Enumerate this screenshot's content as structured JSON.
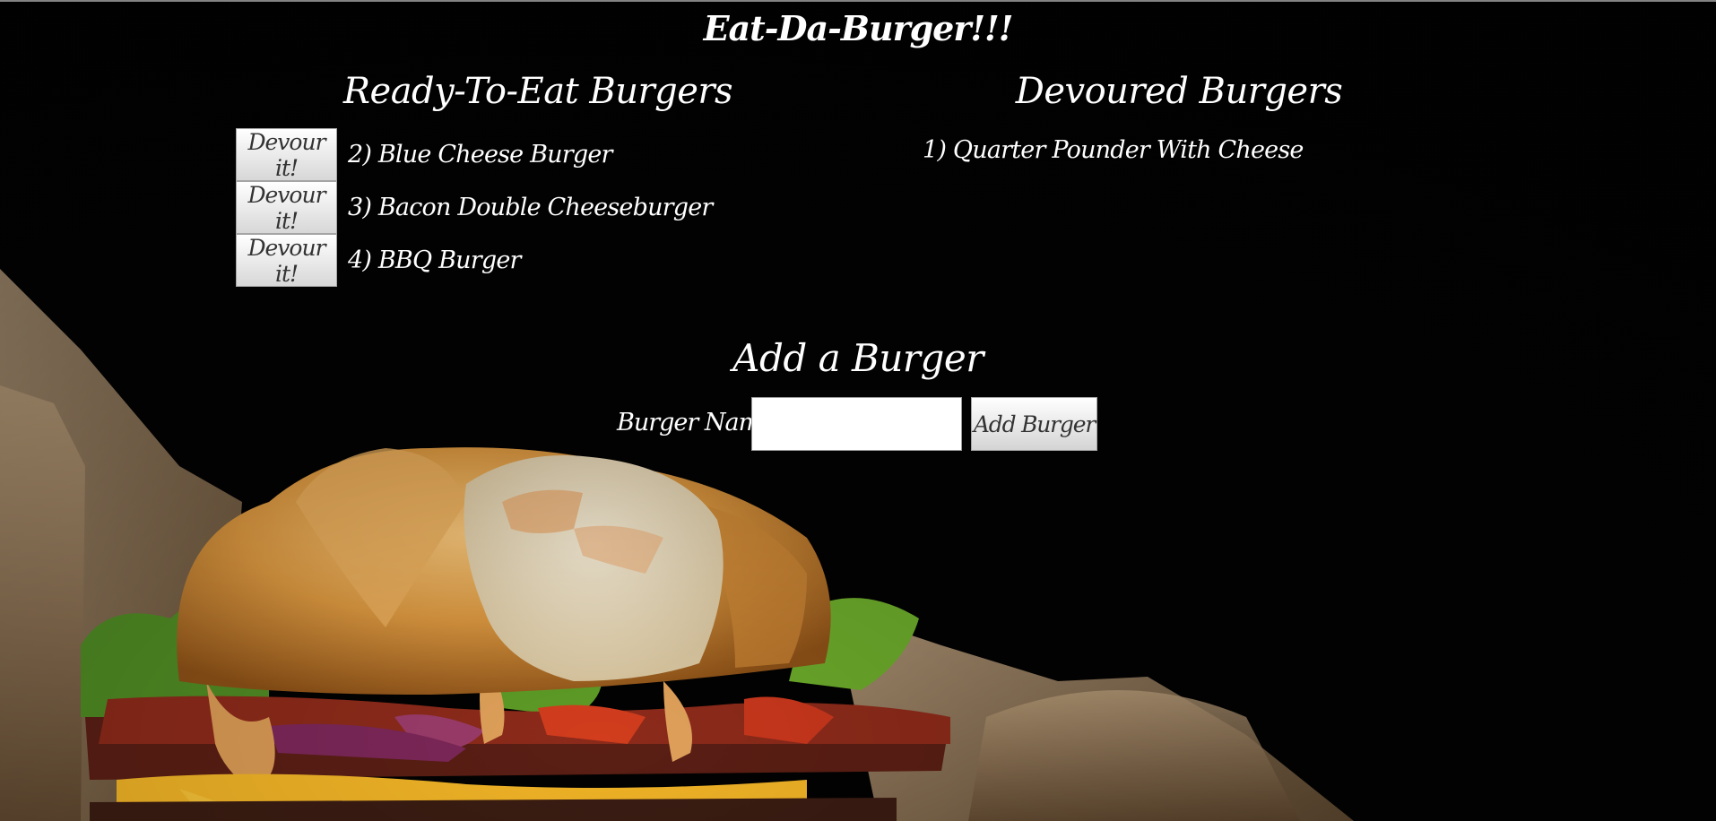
{
  "app": {
    "title": "Eat-Da-Burger!!!"
  },
  "ready": {
    "heading": "Ready-To-Eat Burgers",
    "items": [
      {
        "button_label": "Devour it!",
        "name": "2) Blue Cheese Burger"
      },
      {
        "button_label": "Devour it!",
        "name": "3) Bacon Double Cheeseburger"
      },
      {
        "button_label": "Devour it!",
        "name": "4) BBQ Burger"
      }
    ]
  },
  "devoured": {
    "heading": "Devoured Burgers",
    "items": [
      {
        "name": "1) Quarter Pounder With Cheese"
      }
    ]
  },
  "add_form": {
    "heading": "Add a Burger",
    "name_label": "Burger Name:",
    "name_value": "",
    "submit_label": "Add Burger"
  },
  "background": {
    "image": "burger-photo",
    "page_color": "#030202",
    "text_color": "#ffffff"
  }
}
